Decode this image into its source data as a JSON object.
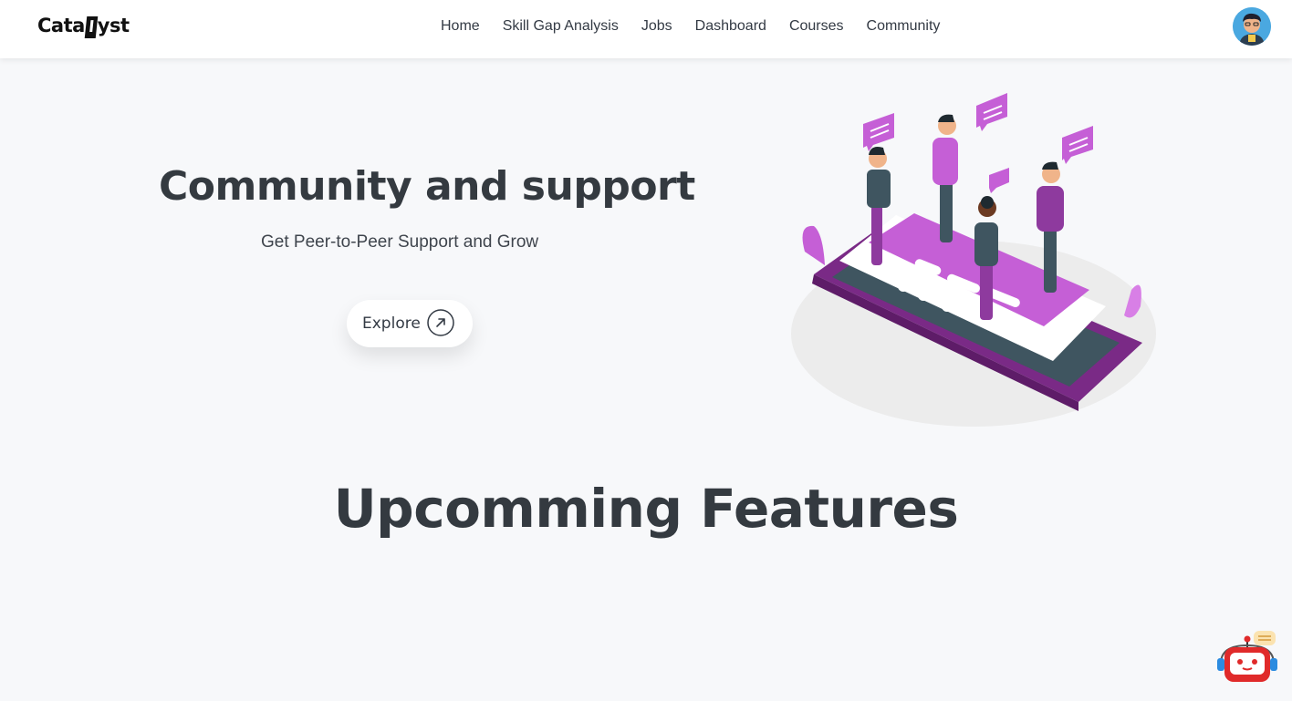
{
  "navbar": {
    "logo_prefix": "Cata",
    "logo_bolt": "l",
    "logo_suffix": "yst",
    "links": [
      "Home",
      "Skill Gap Analysis",
      "Jobs",
      "Dashboard",
      "Courses",
      "Community"
    ]
  },
  "hero": {
    "title": "Community and support",
    "subtitle": "Get Peer-to-Peer Support and Grow",
    "explore_label": "Explore",
    "explore_icon": "arrow-up-right-icon",
    "illustration": "community-chat-illustration"
  },
  "features": {
    "title": "Upcomming Features"
  },
  "chatbot": {
    "icon": "robot-chatbot-icon"
  },
  "colors": {
    "accent_purple": "#a944c0",
    "dark_text": "#343a40",
    "background": "#f7f8fa"
  }
}
